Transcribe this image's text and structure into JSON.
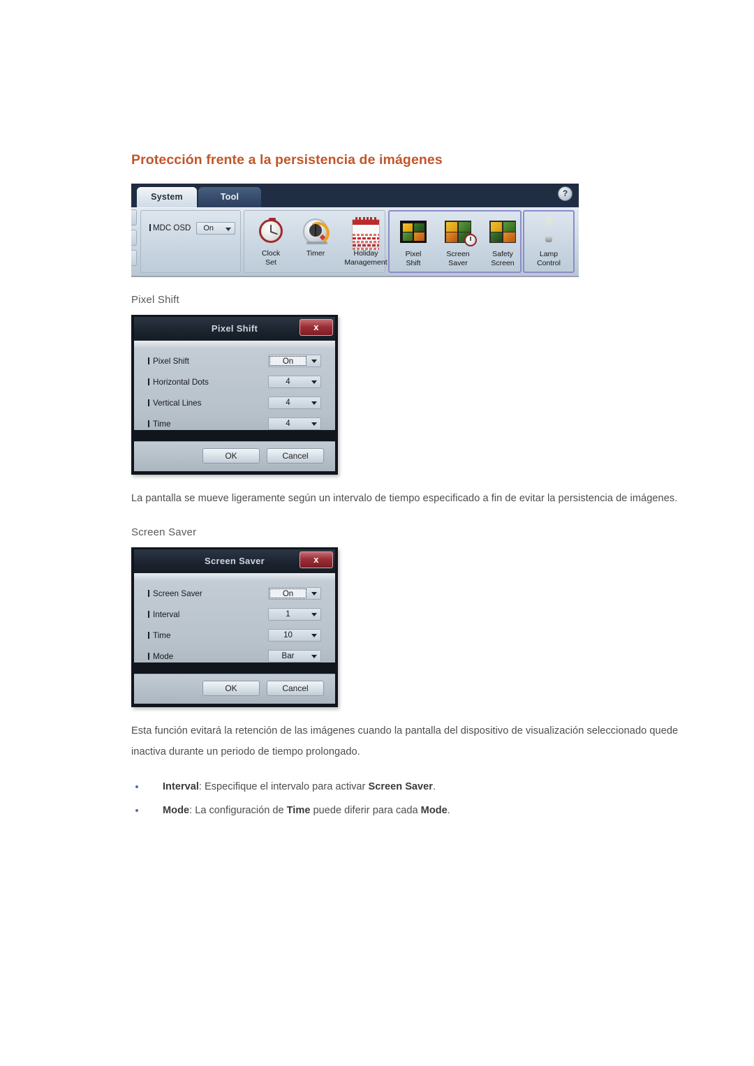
{
  "document": {
    "title": "Protección frente a la persistencia de imágenes"
  },
  "ribbon": {
    "tabs": [
      {
        "label": "System",
        "active": true
      },
      {
        "label": "Tool",
        "active": false
      }
    ],
    "help_icon_label": "?",
    "osd": {
      "label": "MDC OSD",
      "value": "On"
    },
    "groups": [
      {
        "name": "clock-group",
        "items": [
          {
            "icon": "clock-set-icon",
            "line1": "Clock",
            "line2": "Set"
          },
          {
            "icon": "timer-icon",
            "line1": "Timer",
            "line2": ""
          },
          {
            "icon": "holiday-management-icon",
            "line1": "Holiday",
            "line2": "Management"
          }
        ]
      },
      {
        "name": "screen-protection-group",
        "highlighted": true,
        "items": [
          {
            "icon": "pixel-shift-icon",
            "line1": "Pixel",
            "line2": "Shift"
          },
          {
            "icon": "screen-saver-icon",
            "line1": "Screen",
            "line2": "Saver"
          },
          {
            "icon": "safety-screen-icon",
            "line1": "Safety",
            "line2": "Screen"
          }
        ]
      },
      {
        "name": "lamp-group",
        "highlighted": true,
        "items": [
          {
            "icon": "lamp-control-icon",
            "line1": "Lamp",
            "line2": "Control"
          }
        ]
      }
    ]
  },
  "sections": [
    {
      "heading": "Pixel Shift",
      "dialog": {
        "title": "Pixel Shift",
        "close_label": "x",
        "rows": [
          {
            "label": "Pixel Shift",
            "value": "On",
            "focused": true
          },
          {
            "label": "Horizontal Dots",
            "value": "4",
            "focused": false
          },
          {
            "label": "Vertical Lines",
            "value": "4",
            "focused": false
          },
          {
            "label": "Time",
            "value": "4",
            "focused": false
          }
        ],
        "ok_label": "OK",
        "cancel_label": "Cancel"
      },
      "paragraph": "La pantalla se mueve ligeramente según un intervalo de tiempo especificado a fin de evitar la persistencia de imágenes."
    },
    {
      "heading": "Screen Saver",
      "dialog": {
        "title": "Screen Saver",
        "close_label": "x",
        "rows": [
          {
            "label": "Screen Saver",
            "value": "On",
            "focused": true
          },
          {
            "label": "Interval",
            "value": "1",
            "focused": false
          },
          {
            "label": "Time",
            "value": "10",
            "focused": false
          },
          {
            "label": "Mode",
            "value": "Bar",
            "focused": false
          }
        ],
        "ok_label": "OK",
        "cancel_label": "Cancel"
      },
      "paragraph": "Esta función evitará la retención de las imágenes cuando la pantalla del dispositivo de visualización seleccionado quede inactiva durante un periodo de tiempo prolongado."
    }
  ],
  "bullets": [
    {
      "term": "Interval",
      "text_before": ": Especifique el intervalo para activar ",
      "emphasis": "Screen Saver",
      "text_after": "."
    },
    {
      "term": "Mode",
      "text_before": ": La configuración de ",
      "emphasis": "Time",
      "text_mid": " puede diferir para cada ",
      "emphasis2": "Mode",
      "text_after": "."
    }
  ],
  "colors": {
    "heading": "#c1562a",
    "body_text": "#4d4d4f",
    "bullet": "#4a6fa8",
    "ribbon_highlight": "#8b8ccb"
  }
}
